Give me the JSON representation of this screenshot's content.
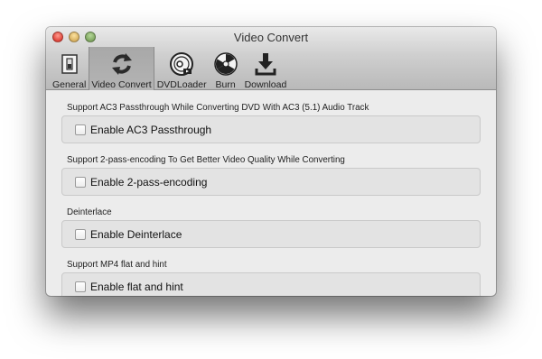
{
  "window": {
    "title": "Video Convert"
  },
  "toolbar": {
    "items": [
      {
        "label": "General",
        "icon": "switch-icon",
        "selected": false
      },
      {
        "label": "Video Convert",
        "icon": "refresh-icon",
        "selected": true
      },
      {
        "label": "DVDLoader",
        "icon": "dvd-disc-icon",
        "selected": false
      },
      {
        "label": "Burn",
        "icon": "burn-radiation-icon",
        "selected": false
      },
      {
        "label": "Download",
        "icon": "download-icon",
        "selected": false
      }
    ]
  },
  "sections": [
    {
      "title": "Support AC3 Passthrough While Converting DVD With AC3 (5.1) Audio Track",
      "checkbox_label": "Enable AC3 Passthrough",
      "checked": false
    },
    {
      "title": "Support 2-pass-encoding To Get Better Video Quality While Converting",
      "checkbox_label": "Enable 2-pass-encoding",
      "checked": false
    },
    {
      "title": "Deinterlace",
      "checkbox_label": "Enable Deinterlace",
      "checked": false
    },
    {
      "title": "Support MP4 flat and hint",
      "checkbox_label": "Enable flat and hint",
      "checked": false
    }
  ]
}
